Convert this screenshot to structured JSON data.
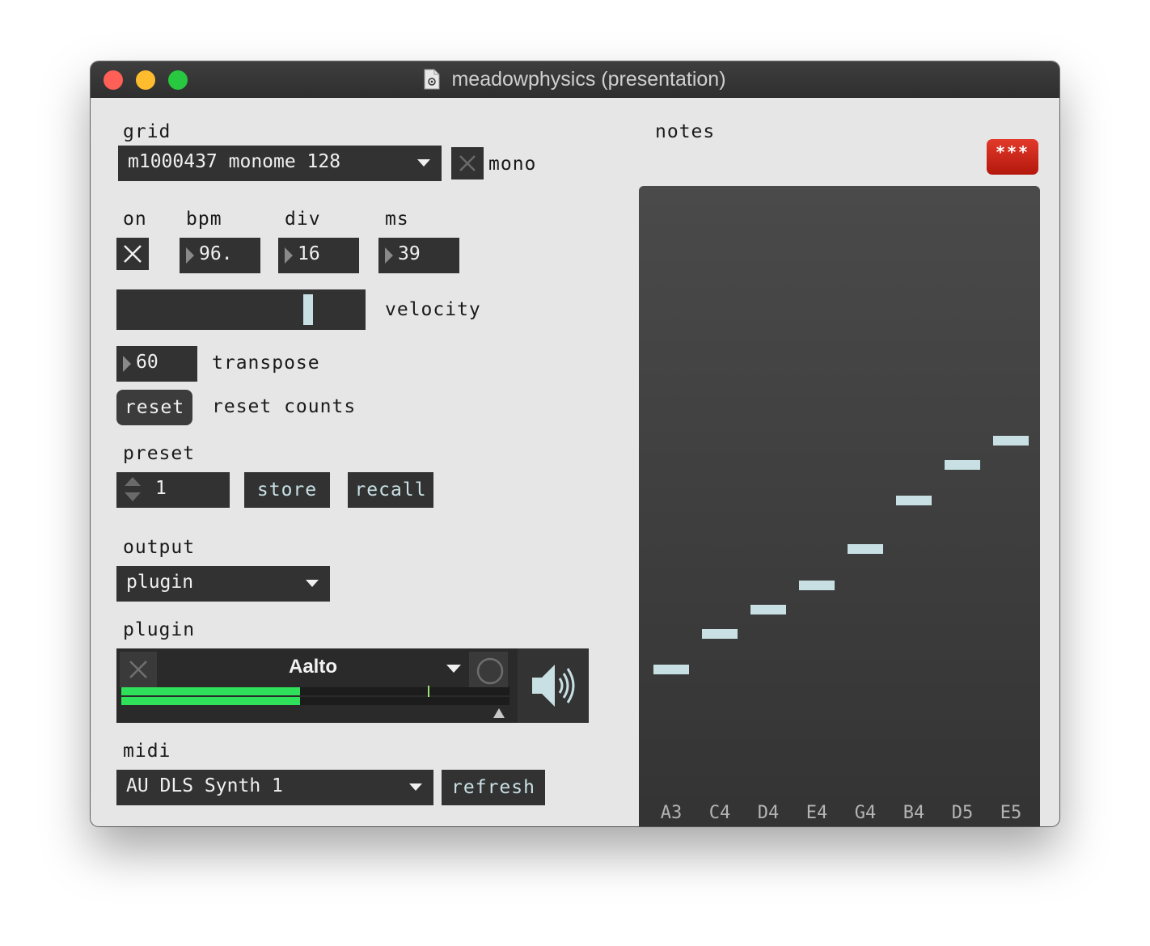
{
  "window": {
    "title": "meadowphysics (presentation)"
  },
  "grid": {
    "label": "grid",
    "device": "m1000437 monome 128",
    "mono_label": "mono"
  },
  "transport": {
    "on_label": "on",
    "bpm_label": "bpm",
    "div_label": "div",
    "ms_label": "ms",
    "bpm": "96.",
    "div": "16",
    "ms": "39"
  },
  "velocity": {
    "label": "velocity",
    "level": 0.77
  },
  "transpose": {
    "value": "60",
    "label": "transpose"
  },
  "reset": {
    "button": "reset",
    "label": "reset counts"
  },
  "preset": {
    "label": "preset",
    "value": "1",
    "store": "store",
    "recall": "recall"
  },
  "output": {
    "label": "output",
    "value": "plugin"
  },
  "plugin": {
    "label": "plugin",
    "name": "Aalto",
    "meter_level": 0.46,
    "meter_peak": 0.79
  },
  "midi": {
    "label": "midi",
    "device": "AU DLS Synth 1",
    "refresh": "refresh"
  },
  "notes": {
    "label": "notes",
    "alert": "***",
    "labels": [
      "A3",
      "C4",
      "D4",
      "E4",
      "G4",
      "B4",
      "D5",
      "E5"
    ],
    "levels": [
      0.264,
      0.318,
      0.355,
      0.392,
      0.447,
      0.521,
      0.575,
      0.612
    ]
  },
  "colors": {
    "accent": "#c8e0e4",
    "meter": "#2fe05a",
    "alert": "#d42a1c",
    "panel": "#323232"
  }
}
